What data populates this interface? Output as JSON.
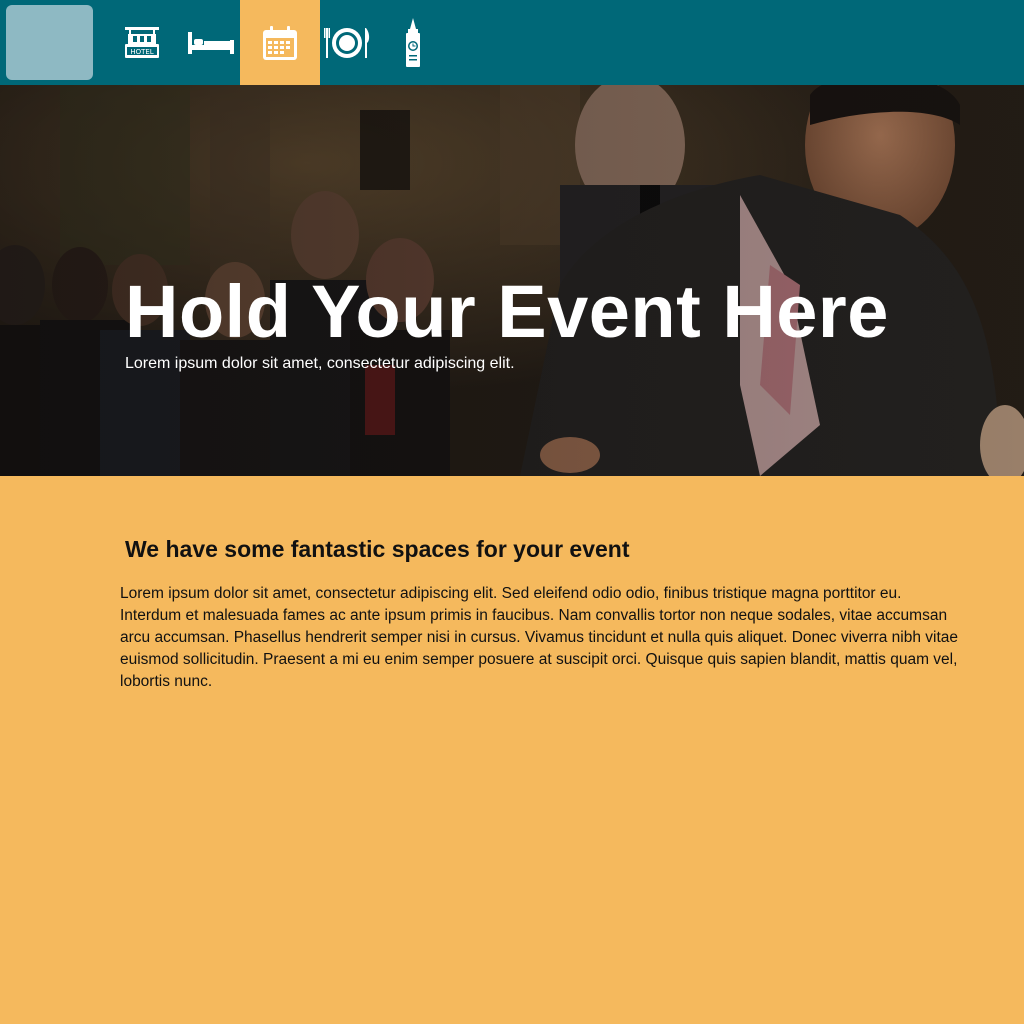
{
  "nav": {
    "items": [
      {
        "icon": "hotel-icon",
        "label": "HOTEL"
      },
      {
        "icon": "bed-icon"
      },
      {
        "icon": "calendar-icon",
        "active": true
      },
      {
        "icon": "dining-icon"
      },
      {
        "icon": "clock-tower-icon"
      }
    ],
    "active_color": "#f5b95d",
    "bar_color": "#006878"
  },
  "hero": {
    "title": "Hold Your Event Here",
    "subtitle": "Lorem ipsum dolor sit amet, consectetur adipiscing elit."
  },
  "content": {
    "heading": "We have some fantastic spaces for your event",
    "body": "Lorem ipsum dolor sit amet, consectetur adipiscing elit. Sed eleifend odio odio, finibus tristique magna porttitor eu. Interdum et malesuada fames ac ante ipsum primis in faucibus. Nam convallis tortor non neque sodales, vitae accumsan arcu accumsan. Phasellus hendrerit semper nisi in cursus. Vivamus tincidunt et nulla quis aliquet. Donec viverra nibh vitae euismod sollicitudin. Praesent a mi eu enim semper posuere at suscipit orci. Quisque quis sapien blandit, mattis quam vel, lobortis nunc."
  },
  "colors": {
    "accent": "#f5b95d",
    "nav": "#006878",
    "logo": "#8eb9c3"
  }
}
